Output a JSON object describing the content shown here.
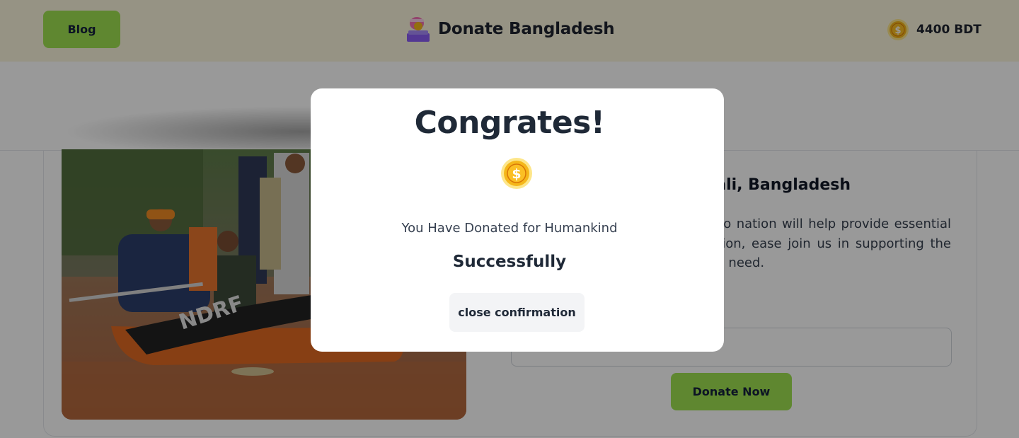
{
  "header": {
    "blog_label": "Blog",
    "title": "Donate Bangladesh",
    "balance": "4400 BDT",
    "logo_icon": "donation-box-icon",
    "coin_icon": "coin-icon"
  },
  "card": {
    "title_visible": "ali, Bangladesh",
    "description_visible": "ave caused significant damage to nation will help provide essential by this disaster. Every contribution, ease join us in supporting the relief pact on the lives of those in need.",
    "amount_value": "",
    "donate_label": "Donate Now",
    "image_alt": "flood rescue boat photo"
  },
  "modal": {
    "title": "Congrates!",
    "message": "You Have Donated for Humankind",
    "status": "Successfully",
    "close_label": "close confirmation",
    "icon": "coin-icon"
  },
  "colors": {
    "accent_green": "#9ee251",
    "header_bg": "#fbf6dd",
    "text_dark": "#1f2937",
    "coin_gold": "#f5b71a"
  }
}
